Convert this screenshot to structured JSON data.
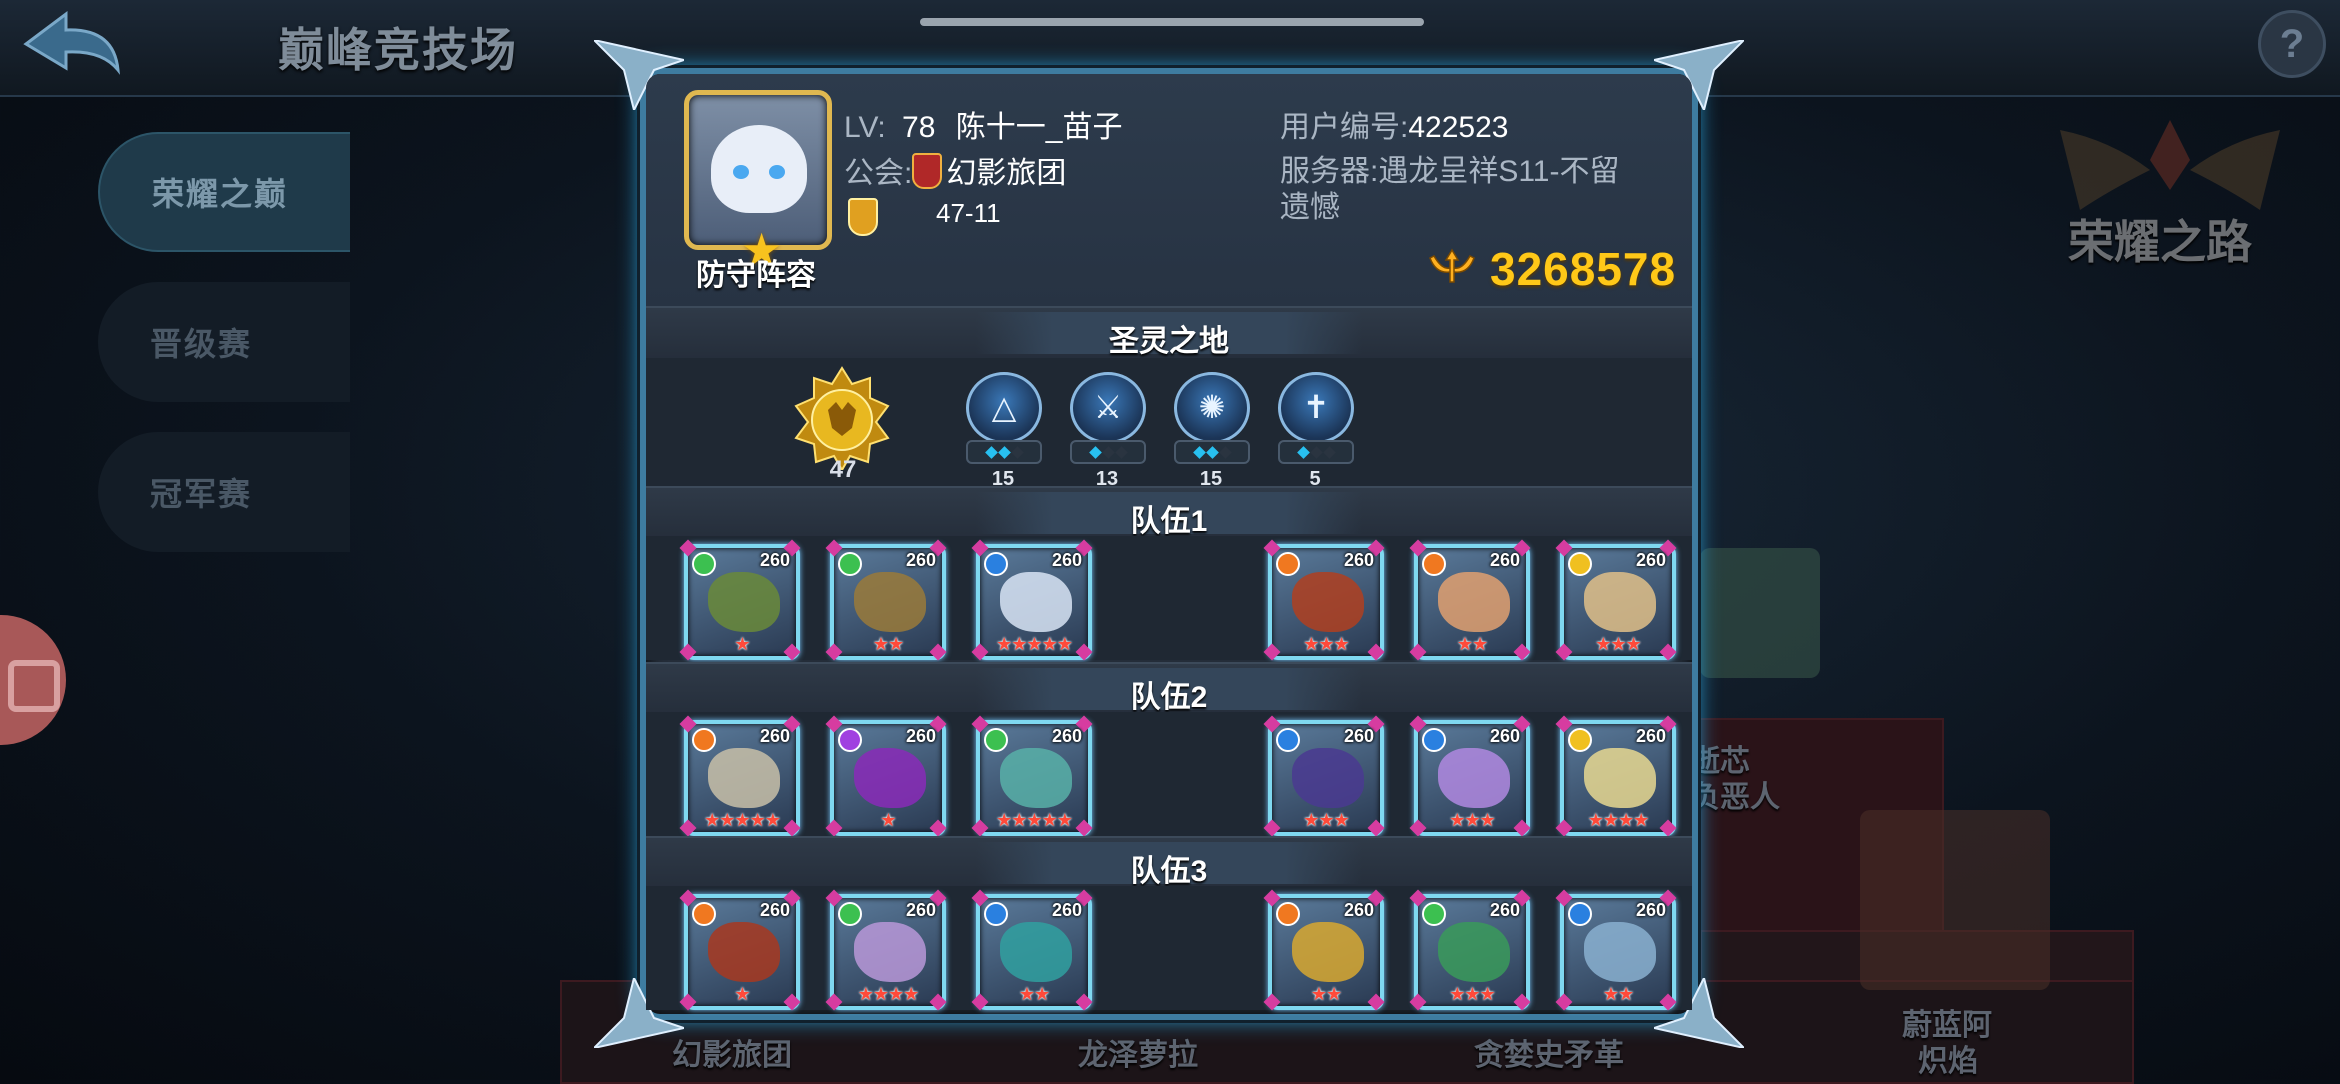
{
  "background": {
    "page_title": "巅峰竞技场",
    "side_tabs": [
      "荣耀之巅",
      "晋级赛",
      "冠军赛"
    ],
    "glory_road_label": "荣耀之路",
    "help_label": "?",
    "bottom_labels": [
      "幻影旅团",
      "龙泽萝拉",
      "贪婪史矛革"
    ],
    "right_label_lines": [
      "蔚蓝阿",
      "炽焰"
    ],
    "mid_right_label_lines": [
      "逝芯",
      "负恶人"
    ]
  },
  "modal": {
    "lineup_label": "防守阵容",
    "lv_label": "LV:",
    "lv_value": "78",
    "player_name": "陈十一_苗子",
    "guild_label": "公会:",
    "guild_name": "幻影旅团",
    "rank_value": "47-11",
    "user_id_label": "用户编号:",
    "user_id": "422523",
    "server_line1": "服务器:遇龙呈祥S11-不留",
    "server_line2": "遗憾",
    "power": "3268578",
    "spirit_section_title": "圣灵之地",
    "medal_level": "47",
    "skills": [
      {
        "icon": "shield-triangle-icon",
        "pips": 2,
        "value": "15"
      },
      {
        "icon": "sword-icon",
        "pips": 1,
        "value": "13"
      },
      {
        "icon": "heal-burst-icon",
        "pips": 2,
        "value": "15"
      },
      {
        "icon": "cross-icon",
        "pips": 1,
        "value": "5"
      }
    ],
    "teams": [
      {
        "title": "队伍1",
        "pets": [
          {
            "element": "wind",
            "element_color": "#3cc050",
            "level": "260",
            "stars": 1,
            "art_color": "#6a8a3a"
          },
          {
            "element": "wind",
            "element_color": "#3cc050",
            "level": "260",
            "stars": 2,
            "art_color": "#9a7a3a"
          },
          {
            "element": "water",
            "element_color": "#2a80e0",
            "level": "260",
            "stars": 5,
            "art_color": "#d8e4f4"
          },
          {
            "element": "fire",
            "element_color": "#f07820",
            "level": "260",
            "stars": 3,
            "art_color": "#b04020"
          },
          {
            "element": "fire",
            "element_color": "#f07820",
            "level": "260",
            "stars": 2,
            "art_color": "#e0a070"
          },
          {
            "element": "light",
            "element_color": "#f0c020",
            "level": "260",
            "stars": 3,
            "art_color": "#e0c088"
          }
        ]
      },
      {
        "title": "队伍2",
        "pets": [
          {
            "element": "fire",
            "element_color": "#f07820",
            "level": "260",
            "stars": 5,
            "art_color": "#c8c0a8"
          },
          {
            "element": "dark",
            "element_color": "#a040e0",
            "level": "260",
            "stars": 1,
            "art_color": "#8a2ab8"
          },
          {
            "element": "wind",
            "element_color": "#3cc050",
            "level": "260",
            "stars": 5,
            "art_color": "#58b0a8"
          },
          {
            "element": "water",
            "element_color": "#2a80e0",
            "level": "260",
            "stars": 3,
            "art_color": "#4a3a90"
          },
          {
            "element": "water",
            "element_color": "#2a80e0",
            "level": "260",
            "stars": 3,
            "art_color": "#b088e0"
          },
          {
            "element": "light",
            "element_color": "#f0c020",
            "level": "260",
            "stars": 4,
            "art_color": "#e8d890"
          }
        ]
      },
      {
        "title": "队伍3",
        "pets": [
          {
            "element": "fire",
            "element_color": "#f07820",
            "level": "260",
            "stars": 1,
            "art_color": "#a83820"
          },
          {
            "element": "wind",
            "element_color": "#3cc050",
            "level": "260",
            "stars": 4,
            "art_color": "#b898d8"
          },
          {
            "element": "water",
            "element_color": "#2a80e0",
            "level": "260",
            "stars": 2,
            "art_color": "#30a0a0"
          },
          {
            "element": "fire",
            "element_color": "#f07820",
            "level": "260",
            "stars": 2,
            "art_color": "#d8a830"
          },
          {
            "element": "wind",
            "element_color": "#3cc050",
            "level": "260",
            "stars": 3,
            "art_color": "#3a9a5a"
          },
          {
            "element": "water",
            "element_color": "#2a80e0",
            "level": "260",
            "stars": 2,
            "art_color": "#8ab0d0"
          }
        ]
      }
    ]
  },
  "colors": {
    "accent_frame": "#3e7ca0",
    "power_gold": "#ffc818",
    "star_red": "#ff4a3a"
  }
}
